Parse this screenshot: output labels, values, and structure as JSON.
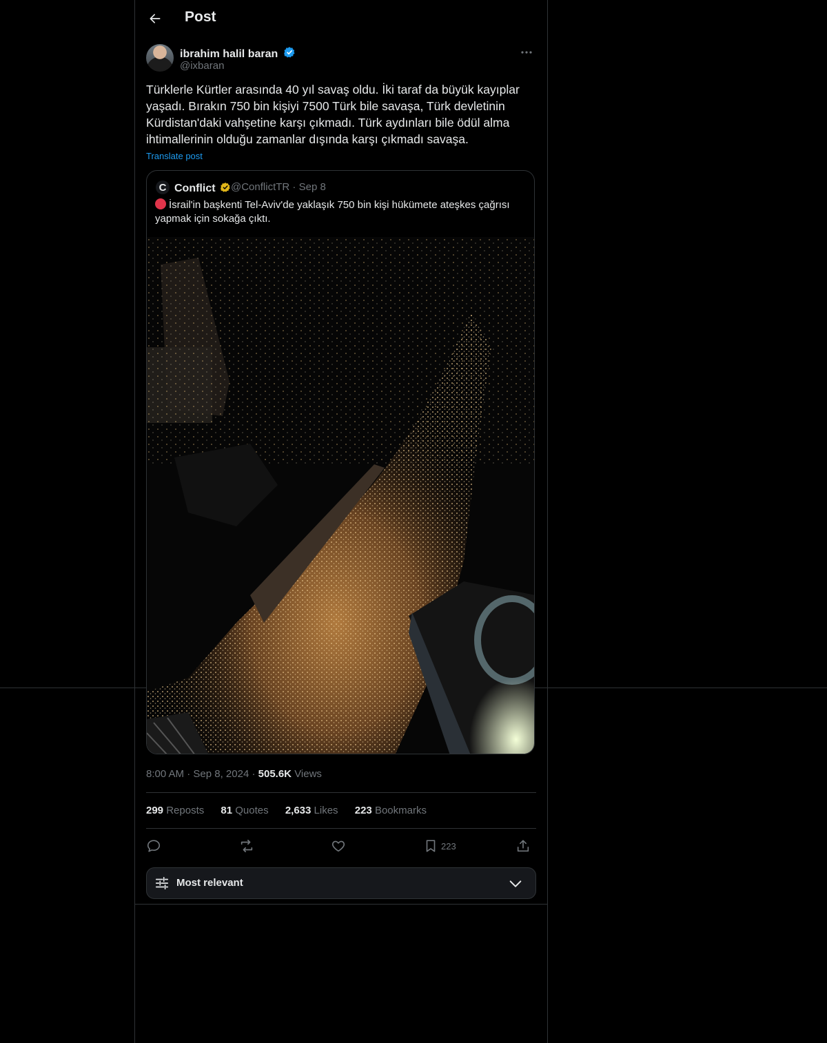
{
  "header": {
    "title": "Post"
  },
  "post": {
    "author_name": "ibrahim halil baran",
    "author_handle": "@ixbaran",
    "text": "Türklerle Kürtler arasında 40 yıl savaş oldu. İki taraf da büyük kayıplar yaşadı. Bırakın 750 bin kişiyi 7500 Türk bile savaşa, Türk devletinin Kürdistan'daki vahşetine karşı çıkmadı. Türk aydınları bile ödül alma ihtimallerinin olduğu zamanlar dışında karşı çıkmadı savaşa.",
    "translate_label": "Translate post",
    "time": "8:00 AM",
    "date": "Sep 8, 2024",
    "views_count": "505.6K",
    "views_label": "Views"
  },
  "quote": {
    "author_name": "Conflict",
    "avatar_letter": "C",
    "author_handle": "@ConflictTR",
    "date": "Sep 8",
    "text": "İsrail'in başkenti Tel-Aviv'de yaklaşık 750 bin kişi hükümete ateşkes çağrısı yapmak için sokağa çıktı."
  },
  "stats": [
    {
      "count": "299",
      "label": "Reposts"
    },
    {
      "count": "81",
      "label": "Quotes"
    },
    {
      "count": "2,633",
      "label": "Likes"
    },
    {
      "count": "223",
      "label": "Bookmarks"
    }
  ],
  "actions": {
    "bookmark_count": "223"
  },
  "sort": {
    "label": "Most relevant"
  },
  "colors": {
    "accent": "#1d9bf0",
    "gold_badge": "#e2b719",
    "background": "#000000",
    "border": "#2f3336"
  }
}
